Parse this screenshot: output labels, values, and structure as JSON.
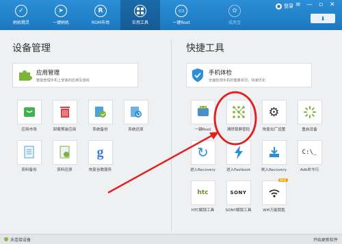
{
  "nav": {
    "items": [
      {
        "label": "刷机精灵",
        "icon": "shield-icon"
      },
      {
        "label": "一键刷机",
        "icon": "cursor-icon"
      },
      {
        "label": "ROM市场",
        "icon": "rom-r-icon"
      },
      {
        "label": "实用工具",
        "icon": "grid-icon"
      },
      {
        "label": "一键Root",
        "icon": "device-icon"
      },
      {
        "label": "成用宝",
        "icon": "app-store-icon"
      }
    ],
    "active": "实用工具",
    "login_label": "登录",
    "download_icon": "download-arrow-icon"
  },
  "device_management": {
    "title": "设备管理",
    "feature": {
      "title": "应用管理",
      "subtitle": "智能管理手机上安装的应用及游戏"
    },
    "tiles": [
      {
        "label": "应用市场",
        "icon": "app-market-icon"
      },
      {
        "label": "卸载预装应用",
        "icon": "trash-icon"
      },
      {
        "label": "系统备份",
        "icon": "system-backup-icon"
      },
      {
        "label": "系统还原",
        "icon": "system-restore-icon"
      },
      {
        "label": "资料备份",
        "icon": "data-backup-icon"
      },
      {
        "label": "资料还原",
        "icon": "data-restore-icon"
      },
      {
        "label": "恢复谷歌服务",
        "icon": "google-g-icon"
      }
    ]
  },
  "quick_tools": {
    "title": "快捷工具",
    "feature": {
      "title": "手机体检",
      "subtitle": "全面检测手机的健康状况，快速优化"
    },
    "tiles": [
      {
        "label": "一键Root",
        "icon": "android-root-icon"
      },
      {
        "label": "清除锁屏密码",
        "icon": "unlock-pattern-icon"
      },
      {
        "label": "恢复出厂设置",
        "icon": "gears-icon"
      },
      {
        "label": "重启设备",
        "icon": "reboot-spinner-icon"
      },
      {
        "label": "进入Recovery",
        "icon": "refresh-arrow-icon"
      },
      {
        "label": "进入Fastboot",
        "icon": "lightning-icon"
      },
      {
        "label": "刷入Recovery",
        "icon": "download-box-icon"
      },
      {
        "label": "Adb命令行",
        "icon": "terminal-icon",
        "glyph": "C:\\_"
      },
      {
        "label": "HTC解锁工具",
        "icon": "htc-icon",
        "glyph": "htc"
      },
      {
        "label": "SONY解锁工具",
        "icon": "sony-icon",
        "glyph": "SONY"
      },
      {
        "label": "Wifi万能钥匙",
        "icon": "wifi-key-icon",
        "badge": "NEW"
      }
    ]
  },
  "status": {
    "left": "未连接设备",
    "right": "开始更新软件"
  },
  "colors": {
    "topbar": "#1c78c0",
    "annotation": "#e41f1f",
    "android_green": "#8fb43a"
  }
}
